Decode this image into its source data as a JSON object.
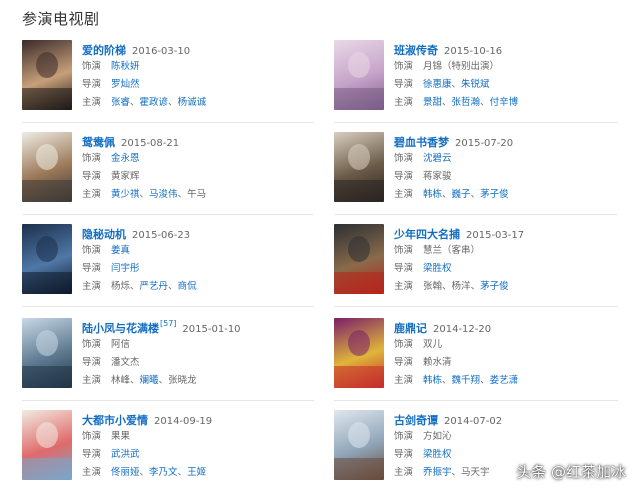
{
  "section_title": "参演电视剧",
  "labels": {
    "role": "饰演",
    "director": "导演",
    "cast": "主演"
  },
  "watermark": "头条 @红茶加冰",
  "shows": [
    {
      "title": "爱的阶梯",
      "date": "2016-03-10",
      "role": [
        {
          "text": "陈秋妍",
          "link": true
        }
      ],
      "director": [
        {
          "text": "罗灿然",
          "link": true
        }
      ],
      "cast": [
        {
          "text": "张睿",
          "link": true
        },
        {
          "text": "霍政谚",
          "link": true
        },
        {
          "text": "杨诚诚",
          "link": true
        }
      ],
      "poster_colors": [
        "#3a2a2a",
        "#c7a07a",
        "#1f1a18"
      ]
    },
    {
      "title": "班淑传奇",
      "date": "2015-10-16",
      "role": [
        {
          "text": "月锦（特别出演）",
          "link": false
        }
      ],
      "director": [
        {
          "text": "徐惠康",
          "link": true
        },
        {
          "text": "朱锐斌",
          "link": true
        }
      ],
      "cast": [
        {
          "text": "景甜",
          "link": true
        },
        {
          "text": "张哲瀚",
          "link": true
        },
        {
          "text": "付辛博",
          "link": true
        }
      ],
      "poster_colors": [
        "#e9d9e6",
        "#c6a2c9",
        "#7a5c86"
      ]
    },
    {
      "title": "鸳鸯佩",
      "date": "2015-08-21",
      "role": [
        {
          "text": "金永恩",
          "link": true
        }
      ],
      "director": [
        {
          "text": "黄家辉",
          "link": false
        }
      ],
      "cast": [
        {
          "text": "黄少祺",
          "link": true
        },
        {
          "text": "马浚伟",
          "link": true
        },
        {
          "text": "午马",
          "link": false
        }
      ],
      "poster_colors": [
        "#efece4",
        "#9c7a5a",
        "#3e3a36"
      ]
    },
    {
      "title": "碧血书香梦",
      "date": "2015-07-20",
      "role": [
        {
          "text": "沈碧云",
          "link": true
        }
      ],
      "director": [
        {
          "text": "蒋家骏",
          "link": false
        }
      ],
      "cast": [
        {
          "text": "韩栋",
          "link": true
        },
        {
          "text": "巍子",
          "link": true
        },
        {
          "text": "茅子俊",
          "link": true
        }
      ],
      "poster_colors": [
        "#d8cfc0",
        "#6b5a48",
        "#2a2520"
      ]
    },
    {
      "title": "隐秘动机",
      "date": "2015-06-23",
      "role": [
        {
          "text": "姜真",
          "link": true
        }
      ],
      "director": [
        {
          "text": "闫宇彤",
          "link": true
        }
      ],
      "cast": [
        {
          "text": "杨烁",
          "link": false
        },
        {
          "text": "严艺丹",
          "link": true
        },
        {
          "text": "商侃",
          "link": true
        }
      ],
      "poster_colors": [
        "#1c2f4a",
        "#4f78a8",
        "#0e1a2a"
      ]
    },
    {
      "title": "少年四大名捕",
      "date": "2015-03-17",
      "role": [
        {
          "text": "慧兰（客串）",
          "link": false
        }
      ],
      "director": [
        {
          "text": "梁胜权",
          "link": true
        }
      ],
      "cast": [
        {
          "text": "张翰",
          "link": false
        },
        {
          "text": "杨洋",
          "link": false
        },
        {
          "text": "茅子俊",
          "link": true
        }
      ],
      "poster_colors": [
        "#2b2f33",
        "#8a6a4a",
        "#b7241c"
      ]
    },
    {
      "title": "陆小凤与花满楼",
      "ref": "[57]",
      "date": "2015-01-10",
      "role": [
        {
          "text": "阿信",
          "link": false
        }
      ],
      "director": [
        {
          "text": "潘文杰",
          "link": false
        }
      ],
      "cast": [
        {
          "text": "林峰",
          "link": false
        },
        {
          "text": "斓曦",
          "link": true
        },
        {
          "text": "张晓龙",
          "link": false
        }
      ],
      "poster_colors": [
        "#c9d8e6",
        "#5e7a92",
        "#233447"
      ]
    },
    {
      "title": "鹿鼎记",
      "date": "2014-12-20",
      "role": [
        {
          "text": "双儿",
          "link": false
        }
      ],
      "director": [
        {
          "text": "赖水清",
          "link": false
        }
      ],
      "cast": [
        {
          "text": "韩栋",
          "link": true
        },
        {
          "text": "魏千翔",
          "link": true
        },
        {
          "text": "娄艺潇",
          "link": true
        }
      ],
      "poster_colors": [
        "#7a1f6a",
        "#e0b53a",
        "#c62c2c"
      ]
    },
    {
      "title": "大都市小爱情",
      "date": "2014-09-19",
      "role": [
        {
          "text": "果果",
          "link": false
        }
      ],
      "director": [
        {
          "text": "武洪武",
          "link": true
        }
      ],
      "cast": [
        {
          "text": "佟丽娅",
          "link": true
        },
        {
          "text": "李乃文",
          "link": true
        },
        {
          "text": "王姬",
          "link": true
        }
      ],
      "poster_colors": [
        "#f2ebe3",
        "#e06a6a",
        "#7aa6c9"
      ]
    },
    {
      "title": "古剑奇谭",
      "date": "2014-07-02",
      "role": [
        {
          "text": "方如沁",
          "link": false
        }
      ],
      "director": [
        {
          "text": "梁胜权",
          "link": true
        }
      ],
      "cast": [
        {
          "text": "乔振宇",
          "link": true
        },
        {
          "text": "马天宇",
          "link": false
        }
      ],
      "poster_colors": [
        "#dfe7ee",
        "#8fa4b8",
        "#6a4a3a"
      ]
    }
  ]
}
